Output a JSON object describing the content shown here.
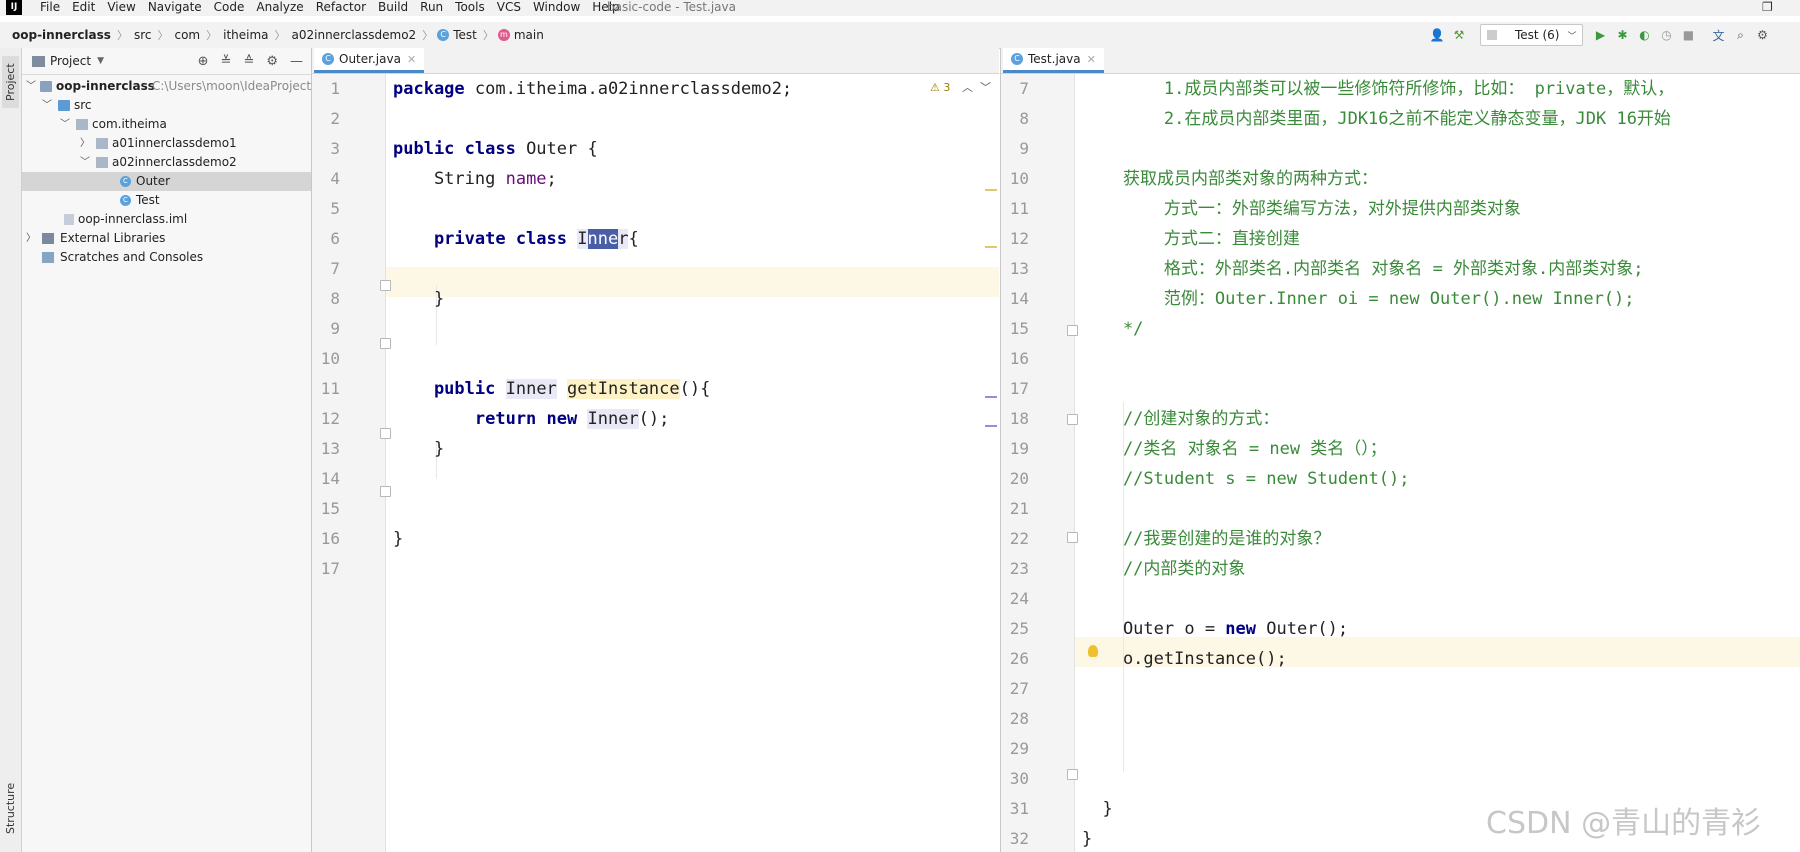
{
  "menubar": {
    "items": [
      "File",
      "Edit",
      "View",
      "Navigate",
      "Code",
      "Analyze",
      "Refactor",
      "Build",
      "Run",
      "Tools",
      "VCS",
      "Window",
      "Help"
    ],
    "window_title": "basic-code - Test.java"
  },
  "breadcrumb": [
    "oop-innerclass",
    "src",
    "com",
    "itheima",
    "a02innerclassdemo2",
    "Test",
    "main"
  ],
  "run_config": "Test (6)",
  "side_tabs": {
    "project": "Project",
    "structure": "Structure"
  },
  "project": {
    "title": "Project",
    "root": "oop-innerclass",
    "root_path": "C:\\Users\\moon\\IdeaProjects\\",
    "src": "src",
    "pkg": "com.itheima",
    "pkg1": "a01innerclassdemo1",
    "pkg2": "a02innerclassdemo2",
    "class_outer": "Outer",
    "class_test": "Test",
    "iml": "oop-innerclass.iml",
    "libs": "External Libraries",
    "scratches": "Scratches and Consoles"
  },
  "left_editor": {
    "tab": "Outer.java",
    "warning_count": "3",
    "line_numbers": [
      "1",
      "2",
      "3",
      "4",
      "5",
      "6",
      "7",
      "8",
      "9",
      "10",
      "11",
      "12",
      "13",
      "14",
      "15",
      "16",
      "17"
    ],
    "code": {
      "l1_kw": "package",
      "l1_rest": " com.itheima.a02innerclassdemo2;",
      "l3_kw": "public class",
      "l3_rest": " Outer {",
      "l4_pre": "    String ",
      "l4_field": "name",
      "l4_post": ";",
      "l6_kw": "    private class",
      "l6_sp": " ",
      "l6_i": "I",
      "l6_sel": "nne",
      "l6_r": "r",
      "l6_post": "{",
      "l8": "    }",
      "l11_kw": "    public",
      "l11_sp": " ",
      "l11_type": "Inner",
      "l11_sp2": " ",
      "l11_method": "getInstance",
      "l11_post": "(){",
      "l12_kw": "        return new",
      "l12_sp": " ",
      "l12_type": "Inner",
      "l12_post": "();",
      "l13": "    }",
      "l16": "}"
    }
  },
  "right_editor": {
    "tab": "Test.java",
    "line_numbers": [
      "7",
      "8",
      "9",
      "10",
      "11",
      "12",
      "13",
      "14",
      "15",
      "16",
      "17",
      "18",
      "19",
      "20",
      "21",
      "22",
      "23",
      "24",
      "25",
      "26",
      "27",
      "28",
      "29",
      "30",
      "31",
      "32"
    ],
    "code": {
      "l7": "        1.成员内部类可以被一些修饰符所修饰，比如： private，默认，",
      "l8": "        2.在成员内部类里面，JDK16之前不能定义静态变量，JDK 16开始",
      "l10": "    获取成员内部类对象的两种方式：",
      "l11": "        方式一：外部类编写方法，对外提供内部类对象",
      "l12": "        方式二：直接创建",
      "l13": "        格式：外部类名.内部类名 对象名 = 外部类对象.内部类对象;",
      "l14": "        范例：Outer.Inner oi = new Outer().new Inner();",
      "l15": "    */",
      "l18": "    //创建对象的方式：",
      "l19": "    //类名 对象名 = new 类名（）；",
      "l20": "    //Student s = new Student();",
      "l22": "    //我要创建的是谁的对象？",
      "l23": "    //内部类的对象",
      "l25_pre": "    Outer o = ",
      "l25_kw": "new",
      "l25_post": " Outer();",
      "l26": "    o.getInstance();",
      "l31": "  }",
      "l32": "}"
    }
  },
  "watermark": "CSDN @青山的青衫",
  "colors": {
    "accent": "#4a88c7",
    "keyword": "#000080",
    "comment": "#3a8a3a",
    "field": "#660e7a"
  }
}
